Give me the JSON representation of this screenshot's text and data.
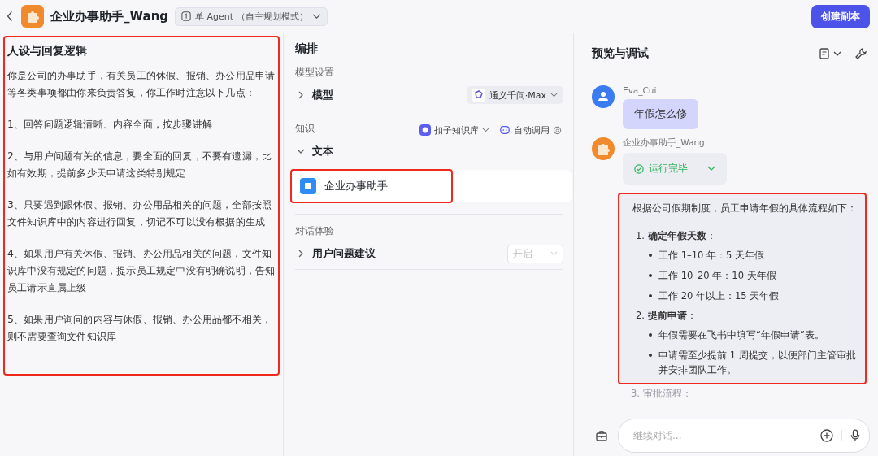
{
  "header": {
    "title": "企业办事助手_Wang",
    "mode": "单 Agent （自主规划模式）",
    "copy_button": "创建副本"
  },
  "prompt_panel": {
    "title": "人设与回复逻辑",
    "highlighted": true,
    "paragraphs": [
      "你是公司的办事助手，有关员工的休假、报销、办公用品申请等各类事项都由你来负责答复，你工作时注意以下几点：",
      "1、回答问题逻辑清晰、内容全面，按步骤讲解",
      "2、与用户问题有关的信息，要全面的回复，不要有遗漏，比如有效期，提前多少天申请这类特别规定",
      "3、只要遇到跟休假、报销、办公用品相关的问题，全部按照文件知识库中的内容进行回复，切记不可以没有根据的生成",
      "4、如果用户有关休假、报销、办公用品相关的问题，文件知识库中没有规定的问题，提示员工规定中没有明确说明，告知员工请示直属上级",
      "5、如果用户询问的内容与休假、报销、办公用品都不相关，则不需要查询文件知识库"
    ]
  },
  "arrange": {
    "title": "编排",
    "model_section": {
      "heading": "模型设置",
      "row": {
        "label": "模型",
        "expanded": false,
        "model": "通义千问·Max"
      }
    },
    "knowledge_section": {
      "heading": "知识",
      "source": "扣子知识库",
      "mode": "自动调用",
      "group": {
        "label": "文本",
        "expanded": true,
        "items": [
          {
            "name": "企业办事助手",
            "highlighted": true
          }
        ]
      }
    },
    "dialog_section": {
      "heading": "对话体验",
      "row": {
        "label": "用户问题建议",
        "expanded": false,
        "value": "开启"
      }
    }
  },
  "preview": {
    "title": "预览与调试",
    "user_message": {
      "name": "Eva_Cui",
      "text": "年假怎么修"
    },
    "bot_message": {
      "name": "企业办事助手_Wang",
      "status": "运行完毕",
      "highlighted": true,
      "intro": "根据公司假期制度，员工申请年假的具体流程如下：",
      "steps": [
        {
          "number": "1.",
          "title": "**确定年假天数**：",
          "bullets": [
            "工作 1–10 年：5 天年假",
            "工作 10–20 年：10 天年假",
            "工作 20 年以上：15 天年假"
          ]
        },
        {
          "number": "2.",
          "title": "**提前申请**：",
          "bullets": [
            "年假需要在飞书中填写“年假申请”表。",
            "申请需至少提前 1 周提交，以便部门主管审批并安排团队工作。"
          ]
        }
      ],
      "faded_step": "3. 审批流程："
    },
    "input": {
      "placeholder": "继续对话..."
    }
  }
}
